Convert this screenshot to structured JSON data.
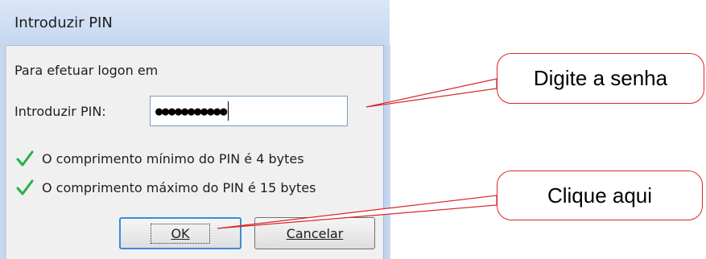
{
  "dialog": {
    "title": "Introduzir PIN",
    "prompt": "Para efetuar logon em",
    "pin_label": "Introduzir PIN:",
    "pin_masked": "●●●●●●●●●●●",
    "rules": [
      "O comprimento mínimo do PIN é 4 bytes",
      "O comprimento máximo do PIN é 15 bytes"
    ],
    "ok_label": "OK",
    "cancel_label": "Cancelar"
  },
  "callouts": {
    "enter_password": "Digite a senha",
    "click_here": "Clique aqui"
  },
  "colors": {
    "callout_border": "#d9262c",
    "check": "#22b14c",
    "focus_border": "#3b8dd6"
  },
  "icons": {
    "rule_ok": "checkmark-icon"
  }
}
